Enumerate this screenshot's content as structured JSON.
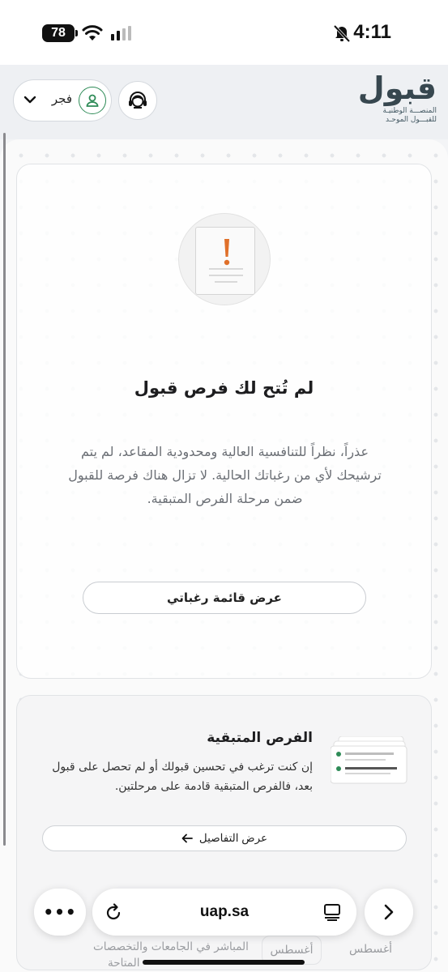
{
  "status_bar": {
    "battery": "78",
    "time": "4:11"
  },
  "browser": {
    "url": "uap.sa",
    "more_label": "•••"
  },
  "header": {
    "logo_text": "قبول",
    "logo_subtitle_1": "المنصـــة الوطنيـة",
    "logo_subtitle_2": "للقبـــول الموحـد",
    "user_name": "فجر"
  },
  "empty_state": {
    "title": "لم تُتح لك فرص قبول",
    "description": "عذراً، نظراً للتنافسية العالية ومحدودية المقاعد، لم يتم ترشيحك لأي من رغباتك الحالية. لا تزال هناك فرصة للقبول ضمن مرحلة الفرص المتبقية.",
    "button_label": "عرض قائمة رغباتي"
  },
  "remaining": {
    "title": "الفرص المتبقية",
    "description": "إن كنت ترغب في تحسين قبولك أو لم تحصل على قبول بعد، فالفرص المتبقية قادمة على مرحلتين.",
    "button_label": "عرض التفاصيل"
  },
  "timeline": {
    "month_1": "أغسطس",
    "month_2": "أغسطس",
    "text_1": "المباشر في الجامعات والتخصصات",
    "text_2": "المتاحة"
  },
  "colors": {
    "accent_green": "#2e8b57",
    "warning_orange": "#e0702a",
    "logo_slate": "#37474f"
  }
}
